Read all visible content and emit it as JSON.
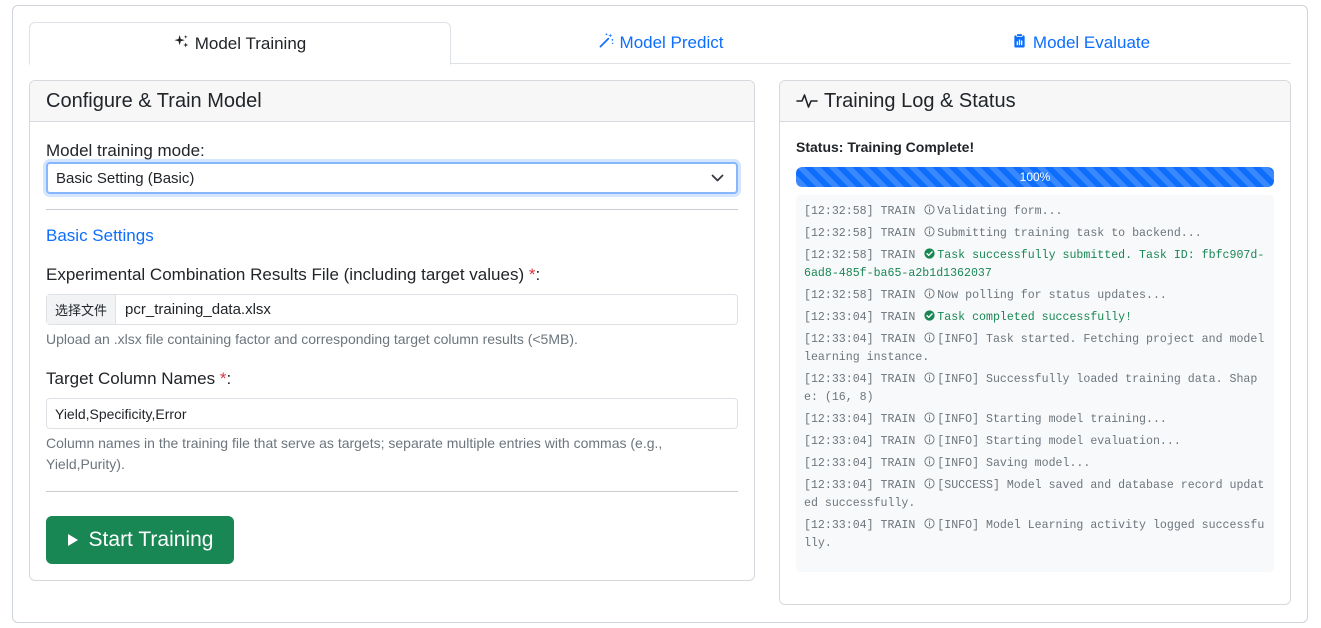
{
  "tabs": [
    {
      "label": "Model Training",
      "icon": "sparkles-icon",
      "active": true
    },
    {
      "label": "Model Predict",
      "icon": "magic-wand-icon",
      "active": false
    },
    {
      "label": "Model Evaluate",
      "icon": "clipboard-icon",
      "active": false
    }
  ],
  "config": {
    "title": "Configure & Train Model",
    "mode_label": "Model training mode:",
    "mode_value": "Basic Setting (Basic)",
    "section_title": "Basic Settings",
    "file_label": "Experimental Combination Results File (including target values) ",
    "file_button": "选择文件",
    "file_name": "pcr_training_data.xlsx",
    "file_help": "Upload an .xlsx file containing factor and corresponding target column results (<5MB).",
    "target_label": "Target Column Names ",
    "target_value": "Yield,Specificity,Error",
    "target_help_1": "Column names in the training file that serve as targets; separate multiple entries with commas (e.g.,",
    "target_help_2": "Yield,Purity).",
    "required_mark": "*",
    "label_colon": ":",
    "start_button": "Start Training"
  },
  "log_panel": {
    "title": "Training Log & Status",
    "status": "Status: Training Complete!",
    "progress_percent": 100,
    "progress_text": "100%",
    "entries": [
      {
        "time": "[12:32:58] TRAIN",
        "icon": "info-icon",
        "msg": "Validating form..."
      },
      {
        "time": "[12:32:58] TRAIN",
        "icon": "info-icon",
        "msg": "Submitting training task to backend..."
      },
      {
        "time": "[12:32:58] TRAIN",
        "icon": "check-circle-icon",
        "msg": "Task successfully submitted. Task ID: fbfc907d-6ad8-485f-ba65-a2b1d1362037"
      },
      {
        "time": "[12:32:58] TRAIN",
        "icon": "info-icon",
        "msg": "Now polling for status updates..."
      },
      {
        "time": "[12:33:04] TRAIN",
        "icon": "check-circle-icon",
        "msg": "Task completed successfully!"
      },
      {
        "time": "[12:33:04] TRAIN",
        "icon": "info-icon",
        "msg": "[INFO] Task started. Fetching project and model learning instance."
      },
      {
        "time": "[12:33:04] TRAIN",
        "icon": "info-icon",
        "msg": "[INFO] Successfully loaded training data. Shape: (16, 8)"
      },
      {
        "time": "[12:33:04] TRAIN",
        "icon": "info-icon",
        "msg": "[INFO] Starting model training..."
      },
      {
        "time": "[12:33:04] TRAIN",
        "icon": "info-icon",
        "msg": "[INFO] Starting model evaluation..."
      },
      {
        "time": "[12:33:04] TRAIN",
        "icon": "info-icon",
        "msg": "[INFO] Saving model..."
      },
      {
        "time": "[12:33:04] TRAIN",
        "icon": "info-icon",
        "msg": "[SUCCESS] Model saved and database record updated successfully."
      },
      {
        "time": "[12:33:04] TRAIN",
        "icon": "info-icon",
        "msg": "[INFO] Model Learning activity logged successfully."
      }
    ]
  },
  "colors": {
    "primary": "#0d6efd",
    "success": "#198754",
    "danger": "#dc3545",
    "muted": "#6c757d"
  }
}
